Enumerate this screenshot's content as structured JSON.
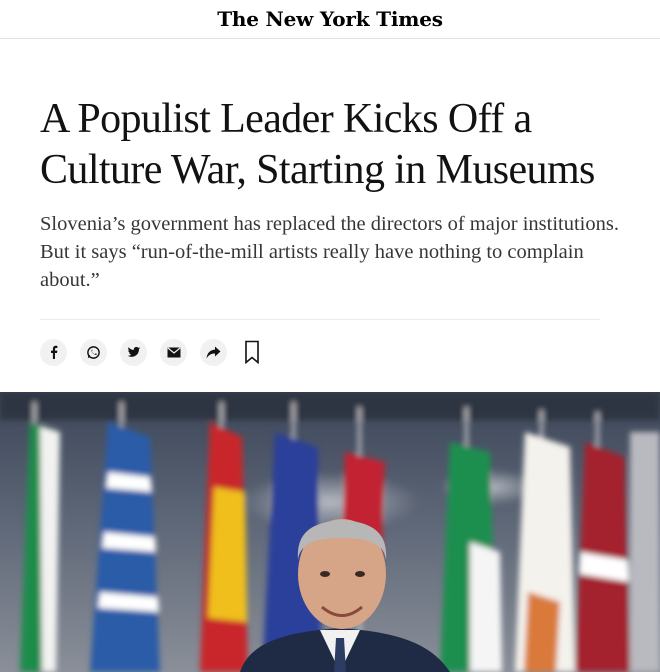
{
  "masthead": {
    "logo_text": "The New York Times"
  },
  "article": {
    "headline": "A Populist Leader Kicks Off a Culture War, Starting in Museums",
    "summary": "Slovenia’s government has replaced the directors of major institutions. But it says “run-of-the-mill artists really have nothing to complain about.”"
  },
  "share_bar": {
    "buttons": [
      {
        "icon": "facebook-icon"
      },
      {
        "icon": "whatsapp-icon"
      },
      {
        "icon": "twitter-icon"
      },
      {
        "icon": "email-icon"
      },
      {
        "icon": "share-arrow-icon"
      }
    ],
    "save_icon": "bookmark-icon"
  },
  "hero_image": {
    "subject": "man-in-suit-smiling-in-front-of-eu-flags",
    "flags": [
      "italy",
      "greece",
      "spain",
      "eu",
      "austria",
      "ireland",
      "cyprus",
      "latvia"
    ]
  },
  "colors": {
    "text": "#121212",
    "summary_text": "#363636",
    "icon_bg": "#f1f1f1",
    "rule": "#e2e2e2"
  }
}
